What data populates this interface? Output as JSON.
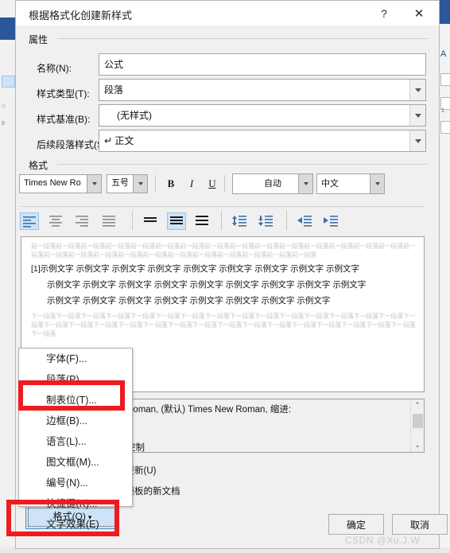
{
  "window": {
    "title": "根据格式化创建新样式",
    "help_icon": "?",
    "close_icon": "✕"
  },
  "properties": {
    "group_label": "属性",
    "name_label": "名称(N):",
    "name_value": "公式",
    "style_type_label": "样式类型(T):",
    "style_type_value": "段落",
    "style_based_label": "样式基准(B):",
    "style_based_value": "(无样式)",
    "next_style_label": "后续段落样式(S):",
    "next_style_value": "↵ 正文"
  },
  "format": {
    "group_label": "格式",
    "font_name": "Times New Ro",
    "font_size": "五号",
    "bold": "B",
    "italic": "I",
    "underline": "U",
    "color": "自动",
    "language": "中文",
    "align_left": "align-left-icon",
    "align_center": "align-center-icon",
    "align_right": "align-right-icon",
    "align_justify": "align-justify-icon",
    "spacing_single": "line-spacing-single-icon",
    "spacing_1_5": "line-spacing-1-5-icon",
    "spacing_double": "line-spacing-double-icon",
    "spacing_increase": "increase-paragraph-spacing-icon",
    "spacing_decrease": "decrease-paragraph-spacing-icon",
    "indent_decrease": "decrease-indent-icon",
    "indent_increase": "increase-indent-icon"
  },
  "preview": {
    "prev_paragraph": "前一段落前一段落前一段落前一段落前一段落前一段落前一段落前一段落前一段落前一段落前一段落前一段落前一段落前一段落前一段落前一段落前一段落前一段落前一段落前一段落前一段落前一段落前一段落前一段落前一段落前一段落前一段落",
    "sample_line_1": "[1]示例文字 示例文字 示例文字 示例文字 示例文字 示例文字 示例文字 示例文字 示例文字",
    "sample_line_2": "示例文字 示例文字 示例文字 示例文字 示例文字 示例文字 示例文字 示例文字 示例文字",
    "sample_line_3": "示例文字 示例文字 示例文字 示例文字 示例文字 示例文字 示例文字 示例文字",
    "next_paragraph": "下一段落下一段落下一段落下一段落下一段落下一段落下一段落下一段落下一段落下一段落下一段落下一段落下一段落下一段落下一段落下一段落下一段落下一段落下一段落下一段落下一段落下一段落下一段落下一段落下一段落下一段落下一段落下一段落下一段落下一段落下一段落下一段落"
  },
  "description": {
    "line_1": "Roman, (默认) Times New Roman, 缩进:",
    "line_2": "控制",
    "scroll_up_icon": "⌃",
    "scroll_down_icon": "⌄"
  },
  "checkboxes": {
    "auto_update": "动更新(U)",
    "new_docs": "该模板的新文档"
  },
  "context_menu": {
    "items": [
      {
        "label": "字体(F)..."
      },
      {
        "label": "段落(P)..."
      },
      {
        "label": "制表位(T)..."
      },
      {
        "label": "边框(B)..."
      },
      {
        "label": "语言(L)..."
      },
      {
        "label": "图文框(M)..."
      },
      {
        "label": "编号(N)..."
      },
      {
        "label": "快捷键(K)..."
      },
      {
        "label": "文字效果(E)"
      }
    ]
  },
  "buttons": {
    "format": "格式(O)",
    "format_arrow": "▾",
    "ok": "确定",
    "cancel": "取消"
  },
  "watermark": "CSDN @Xu.J.W",
  "colors": {
    "accent": "#2b579a",
    "highlight": "#cde3f7",
    "annotation": "#ee1c21",
    "dialog_bg": "#f0f0f0"
  }
}
